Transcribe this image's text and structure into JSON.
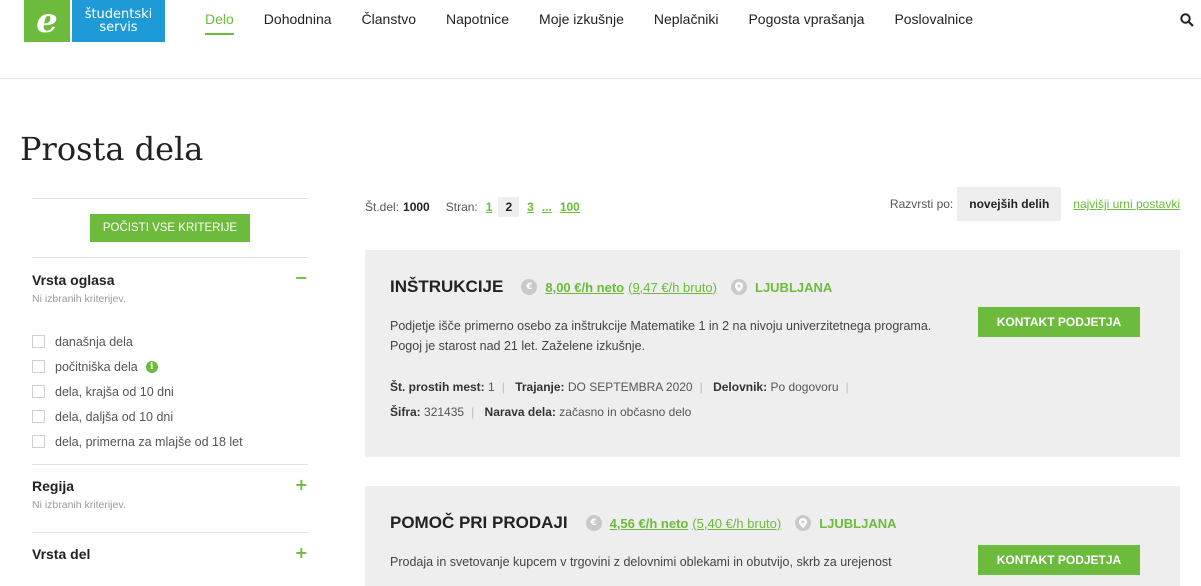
{
  "header": {
    "logo_letter": "e",
    "logo_line1": "študentski",
    "logo_line2": "servis",
    "nav": [
      "Delo",
      "Dohodnina",
      "Članstvo",
      "Napotnice",
      "Moje izkušnje",
      "Neplačniki",
      "Pogosta vprašanja",
      "Poslovalnice"
    ],
    "active_nav": "Delo"
  },
  "page_title": "Prosta dela",
  "sidebar": {
    "clear_label": "POČISTI VSE KRITERIJE",
    "sections": [
      {
        "title": "Vrsta oglasa",
        "subtitle": "Ni izbranih kriterijev.",
        "toggle": "−",
        "options": [
          "današnja dela",
          "počitniška dela",
          "dela, krajša od 10 dni",
          "dela, daljša od 10 dni",
          "dela, primerna za mlajše od 18 let"
        ]
      },
      {
        "title": "Regija",
        "subtitle": "Ni izbranih kriterijev.",
        "toggle": "+"
      },
      {
        "title": "Vrsta del",
        "toggle": "+"
      }
    ]
  },
  "results": {
    "count_label": "Št.del:",
    "count": "1000",
    "page_label": "Stran:",
    "pages": [
      "1",
      "2",
      "3",
      "...",
      "100"
    ],
    "current_page": "2",
    "sort_label": "Razvrsti po:",
    "sort_active": "novejših delih",
    "sort_other": "najvišji urni postavki"
  },
  "jobs": [
    {
      "title": "INŠTRUKCIJE",
      "net": "8,00 €/h neto",
      "gross": "(9,47 €/h bruto)",
      "city": "LJUBLJANA",
      "desc": "Podjetje išče primerno osebo za inštrukcije Matematike 1 in 2 na nivoju univerzitetnega programa. Pogoj je starost nad 21 let. Zaželene izkušnje.",
      "places_label": "Št. prostih mest:",
      "places": "1",
      "duration_label": "Trajanje:",
      "duration": "DO SEPTEMBRA 2020",
      "hours_label": "Delovnik:",
      "hours": "Po dogovoru",
      "code_label": "Šifra:",
      "code": "321435",
      "nature_label": "Narava dela:",
      "nature": "začasno in občasno delo",
      "contact": "KONTAKT PODJETJA"
    },
    {
      "title": "POMOČ PRI PRODAJI",
      "net": "4,56 €/h neto",
      "gross": "(5,40 €/h bruto)",
      "city": "LJUBLJANA",
      "desc": "Prodaja in svetovanje kupcem v trgovini z delovnimi oblekami in obutvijo, skrb za urejenost",
      "contact": "KONTAKT PODJETJA"
    }
  ],
  "colors": {
    "accent": "#6cbb3c",
    "brand_blue": "#1e9bd7",
    "card_bg": "#eeeeee"
  }
}
